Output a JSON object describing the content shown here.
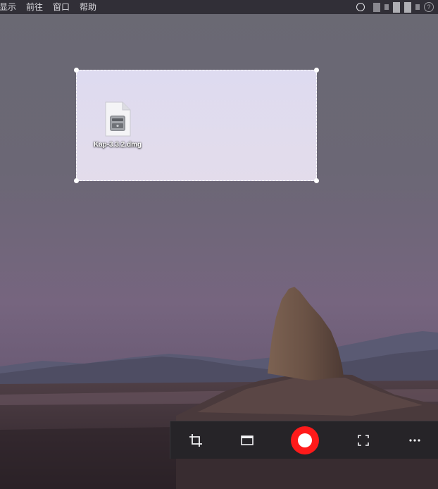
{
  "menubar": {
    "items": [
      {
        "label": "显示"
      },
      {
        "label": "前往"
      },
      {
        "label": "窗口"
      },
      {
        "label": "帮助"
      }
    ]
  },
  "desktop": {
    "file": {
      "name": "Kap-3.3.2.dmg",
      "icon": "dmg-disk-image-icon"
    }
  },
  "toolbar": {
    "buttons": [
      {
        "name": "crop-button",
        "icon": "crop-icon"
      },
      {
        "name": "window-button",
        "icon": "window-icon"
      },
      {
        "name": "record-button",
        "icon": "record-icon"
      },
      {
        "name": "fullscreen-button",
        "icon": "fullscreen-icon"
      },
      {
        "name": "more-button",
        "icon": "more-icon"
      }
    ]
  },
  "colors": {
    "record": "#ff1a1a",
    "toolbar_bg": "#262428",
    "selection_fill": "#dedbf0"
  }
}
